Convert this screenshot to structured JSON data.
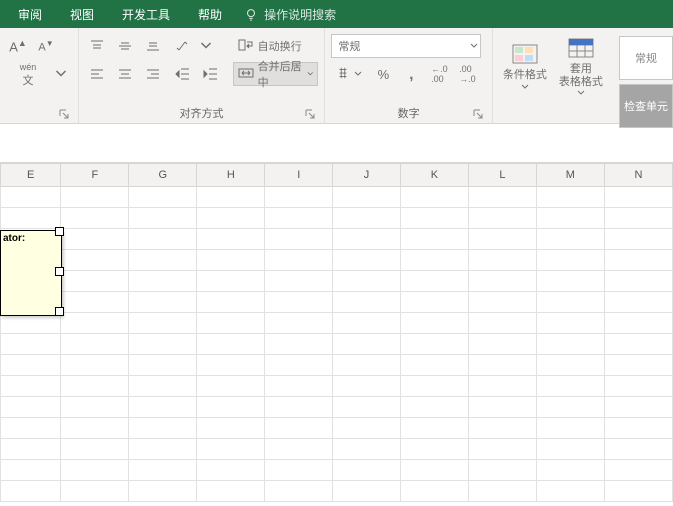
{
  "menu": {
    "review": "审阅",
    "view": "视图",
    "dev": "开发工具",
    "help": "帮助",
    "tellme": "操作说明搜索"
  },
  "font": {
    "wen": "wén",
    "wenSub": "文",
    "launcher": "⌄"
  },
  "align": {
    "label": "对齐方式",
    "wrap": "自动换行",
    "merge": "合并后居中"
  },
  "number": {
    "label": "数字",
    "format": "常规",
    "decInc": ".0",
    "decDec": ".00"
  },
  "styles": {
    "cond": "条件格式",
    "table": "套用\n表格格式",
    "normal": "常规",
    "check": "检查单元"
  },
  "cols": [
    "E",
    "F",
    "G",
    "H",
    "I",
    "J",
    "K",
    "L",
    "M",
    "N"
  ],
  "comment": {
    "text": "ator:"
  }
}
